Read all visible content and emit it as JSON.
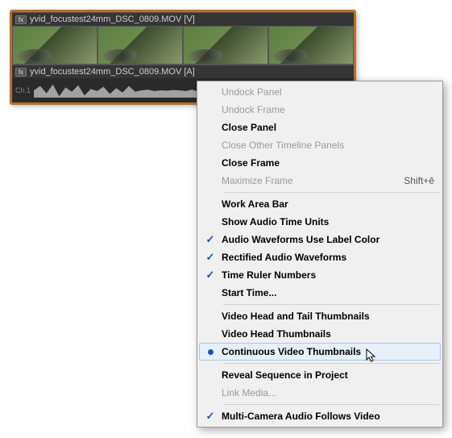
{
  "timeline": {
    "video_track_label": "yvid_focustest24mm_DSC_0809.MOV [V]",
    "audio_track_label": "yvid_focustest24mm_DSC_0809.MOV [A]",
    "fx_badge": "fx",
    "channel_label": "Ch.1"
  },
  "menu": {
    "undock_panel": "Undock Panel",
    "undock_frame": "Undock Frame",
    "close_panel": "Close Panel",
    "close_other_timeline_panels": "Close Other Timeline Panels",
    "close_frame": "Close Frame",
    "maximize_frame": "Maximize Frame",
    "maximize_frame_accel": "Shift+ē",
    "work_area_bar": "Work Area Bar",
    "show_audio_time_units": "Show Audio Time Units",
    "audio_waveforms_use_label_color": "Audio Waveforms Use Label Color",
    "rectified_audio_waveforms": "Rectified Audio Waveforms",
    "time_ruler_numbers": "Time Ruler Numbers",
    "start_time": "Start Time...",
    "video_head_and_tail_thumbnails": "Video Head and Tail Thumbnails",
    "video_head_thumbnails": "Video Head Thumbnails",
    "continuous_video_thumbnails": "Continuous Video Thumbnails",
    "reveal_sequence_in_project": "Reveal Sequence in Project",
    "link_media": "Link Media...",
    "multicam_audio_follows_video": "Multi-Camera Audio Follows Video"
  },
  "icons": {
    "checkmark": "✓"
  }
}
